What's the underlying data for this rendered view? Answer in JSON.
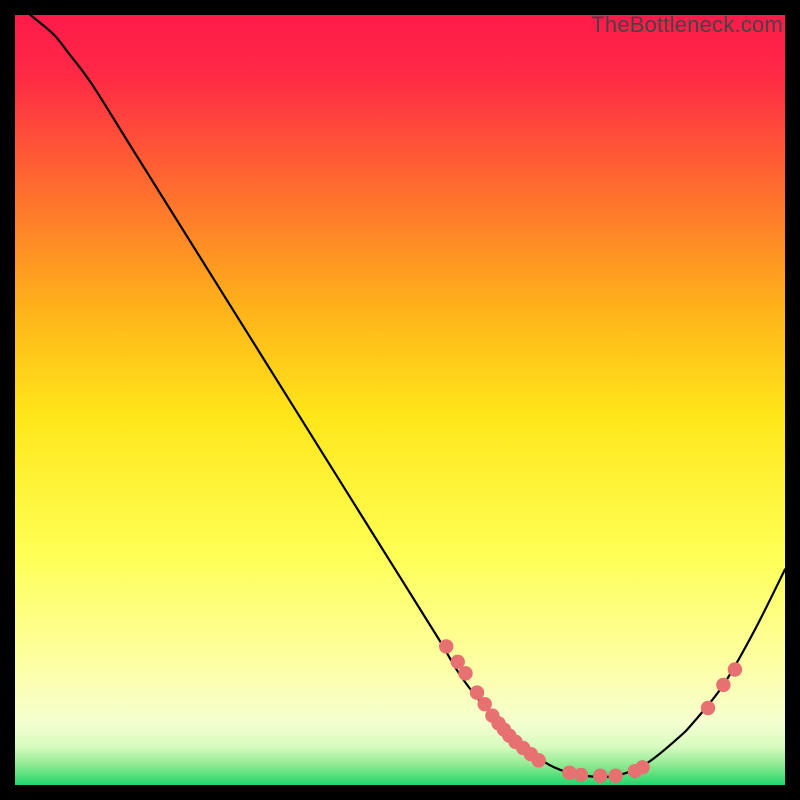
{
  "watermark": "TheBottleneck.com",
  "colors": {
    "gradient_top": "#ff1a4a",
    "gradient_mid_upper": "#ff7a2a",
    "gradient_mid": "#ffd21a",
    "gradient_mid_lower": "#ffff55",
    "gradient_lower": "#f8ffb0",
    "gradient_bottom1": "#baf78a",
    "gradient_bottom2": "#1fd86a",
    "curve_stroke": "#000000",
    "marker_fill": "#e77070",
    "background": "#000000"
  },
  "chart_data": {
    "type": "line",
    "title": "",
    "xlabel": "",
    "ylabel": "",
    "xlim": [
      0,
      100
    ],
    "ylim": [
      0,
      100
    ],
    "series": [
      {
        "name": "curve",
        "x": [
          2,
          5,
          7,
          10,
          15,
          20,
          25,
          30,
          35,
          40,
          45,
          50,
          55,
          58,
          62,
          66,
          70,
          74,
          78,
          82,
          86,
          88,
          92,
          96,
          100
        ],
        "y": [
          100,
          97.5,
          95,
          91,
          83,
          75,
          67,
          59,
          51,
          43,
          35,
          27,
          19,
          14,
          9,
          5,
          2.3,
          1.2,
          1.2,
          2.8,
          6,
          8,
          13,
          20,
          28
        ]
      }
    ],
    "markers": [
      {
        "x": 56,
        "y": 18
      },
      {
        "x": 57.5,
        "y": 16
      },
      {
        "x": 58.5,
        "y": 14.5
      },
      {
        "x": 60,
        "y": 12
      },
      {
        "x": 61,
        "y": 10.5
      },
      {
        "x": 62,
        "y": 9
      },
      {
        "x": 62.8,
        "y": 8
      },
      {
        "x": 63.5,
        "y": 7.2
      },
      {
        "x": 64.2,
        "y": 6.4
      },
      {
        "x": 65,
        "y": 5.6
      },
      {
        "x": 66,
        "y": 4.8
      },
      {
        "x": 67,
        "y": 4
      },
      {
        "x": 68,
        "y": 3.2
      },
      {
        "x": 72,
        "y": 1.6
      },
      {
        "x": 73.5,
        "y": 1.3
      },
      {
        "x": 76,
        "y": 1.2
      },
      {
        "x": 78,
        "y": 1.2
      },
      {
        "x": 80.5,
        "y": 1.8
      },
      {
        "x": 81.5,
        "y": 2.3
      },
      {
        "x": 90,
        "y": 10
      },
      {
        "x": 92,
        "y": 13
      },
      {
        "x": 93.5,
        "y": 15
      }
    ]
  }
}
